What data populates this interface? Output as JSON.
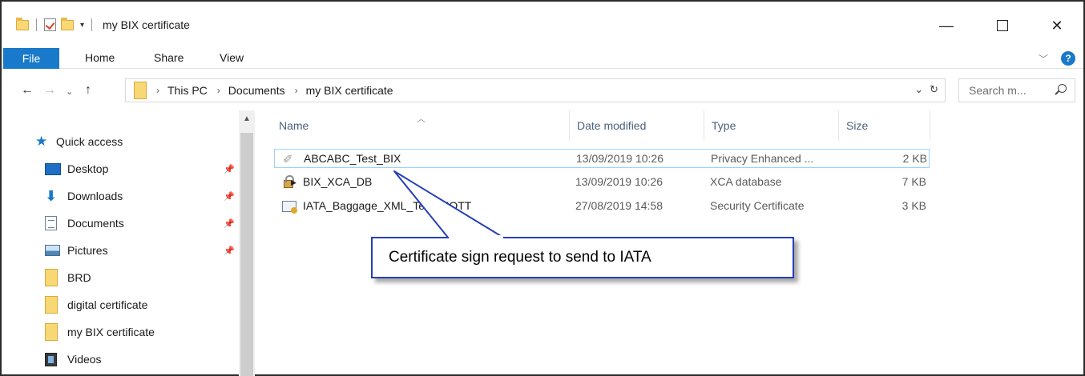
{
  "window": {
    "title": "my BIX certificate",
    "controls": {
      "minimize": "—",
      "maximize": "",
      "close": "✕"
    }
  },
  "ribbon": {
    "tabs": [
      "File",
      "Home",
      "Share",
      "View"
    ],
    "help": "?"
  },
  "navigation": {
    "breadcrumbs": [
      "This PC",
      "Documents",
      "my BIX certificate"
    ],
    "search_placeholder": "Search m..."
  },
  "sidebar": {
    "quick_access": "Quick access",
    "items": [
      {
        "label": "Desktop",
        "icon": "desktop-icon",
        "pinned": true
      },
      {
        "label": "Downloads",
        "icon": "downloads-icon",
        "pinned": true
      },
      {
        "label": "Documents",
        "icon": "documents-icon",
        "pinned": true
      },
      {
        "label": "Pictures",
        "icon": "pictures-icon",
        "pinned": true
      },
      {
        "label": "BRD",
        "icon": "folder-icon",
        "pinned": false
      },
      {
        "label": "digital certificate",
        "icon": "folder-icon",
        "pinned": false
      },
      {
        "label": "my BIX certificate",
        "icon": "folder-icon",
        "pinned": false
      },
      {
        "label": "Videos",
        "icon": "videos-icon",
        "pinned": false
      }
    ]
  },
  "file_list": {
    "columns": [
      "Name",
      "Date modified",
      "Type",
      "Size"
    ],
    "rows": [
      {
        "name": "ABCABC_Test_BIX",
        "date": "13/09/2019 10:26",
        "type": "Privacy Enhanced ...",
        "size": "2 KB",
        "icon": "certificate-request-icon",
        "selected": true
      },
      {
        "name": "BIX_XCA_DB",
        "date": "13/09/2019 10:26",
        "type": "XCA database",
        "size": "7 KB",
        "icon": "lock-database-icon",
        "selected": false
      },
      {
        "name": "IATA_Baggage_XML_Test_MQTT",
        "date": "27/08/2019 14:58",
        "type": "Security Certificate",
        "size": "3 KB",
        "icon": "security-certificate-icon",
        "selected": false
      }
    ]
  },
  "callout": {
    "text": "Certificate sign request to send to IATA"
  },
  "colors": {
    "accent": "#1979ca",
    "selection_border": "#99d1ff",
    "callout_border": "#2540b8"
  }
}
